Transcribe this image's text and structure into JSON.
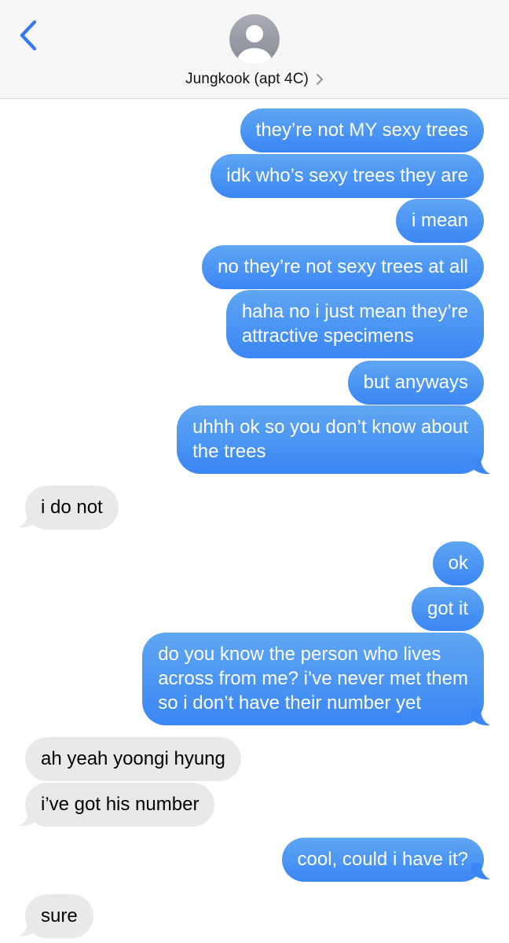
{
  "header": {
    "contact_name": "Jungkook (apt 4C)"
  },
  "colors": {
    "sent_bubble": "#3a86f5",
    "received_bubble": "#e9e9eb",
    "accent": "#3478f6"
  },
  "icons": {
    "back": "chevron-left-icon",
    "avatar": "person-icon",
    "details": "chevron-right-icon"
  },
  "messages": [
    {
      "direction": "sent",
      "text": "they’re not MY sexy trees"
    },
    {
      "direction": "sent",
      "text": "idk who’s sexy trees they are"
    },
    {
      "direction": "sent",
      "text": "i mean"
    },
    {
      "direction": "sent",
      "text": "no they’re not sexy trees at all"
    },
    {
      "direction": "sent",
      "lines": [
        "haha no i just mean they’re",
        "attractive specimens"
      ]
    },
    {
      "direction": "sent",
      "text": "but anyways"
    },
    {
      "direction": "sent",
      "lines": [
        "uhhh ok so you don’t know about",
        "the trees"
      ]
    },
    {
      "direction": "received",
      "text": "i do not"
    },
    {
      "direction": "sent",
      "text": "ok"
    },
    {
      "direction": "sent",
      "text": "got it"
    },
    {
      "direction": "sent",
      "lines": [
        "do you know the person who lives",
        "across from me? i’ve never met them",
        "so i don’t have their number yet"
      ]
    },
    {
      "direction": "received",
      "text": "ah yeah yoongi hyung"
    },
    {
      "direction": "received",
      "text": "i’ve got his number"
    },
    {
      "direction": "sent",
      "text": "cool, could i have it?"
    },
    {
      "direction": "received",
      "text": "sure"
    }
  ]
}
